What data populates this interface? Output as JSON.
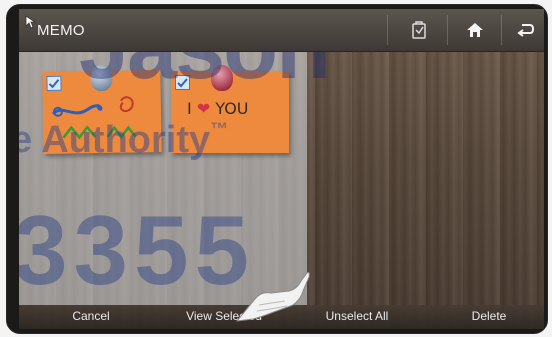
{
  "app": {
    "title": "MEMO"
  },
  "toolbar": {
    "icons": [
      "memo-edit-icon",
      "home-icon",
      "back-icon"
    ]
  },
  "memos": [
    {
      "checked": true,
      "content": ""
    },
    {
      "checked": true,
      "content": "I ❤ YOU",
      "line1": "I",
      "heart": "❤",
      "line2": "YOU"
    }
  ],
  "watermark": {
    "word1": "Jason",
    "word2": "e Authority",
    "tm": "™",
    "number": "3355"
  },
  "bottom_bar": {
    "cancel": "Cancel",
    "view_selected": "View Selected",
    "unselect_all": "Unselect All",
    "delete": "Delete"
  },
  "colors": {
    "memo": "#ee8a3e",
    "accent_check": "#4a78b8"
  }
}
